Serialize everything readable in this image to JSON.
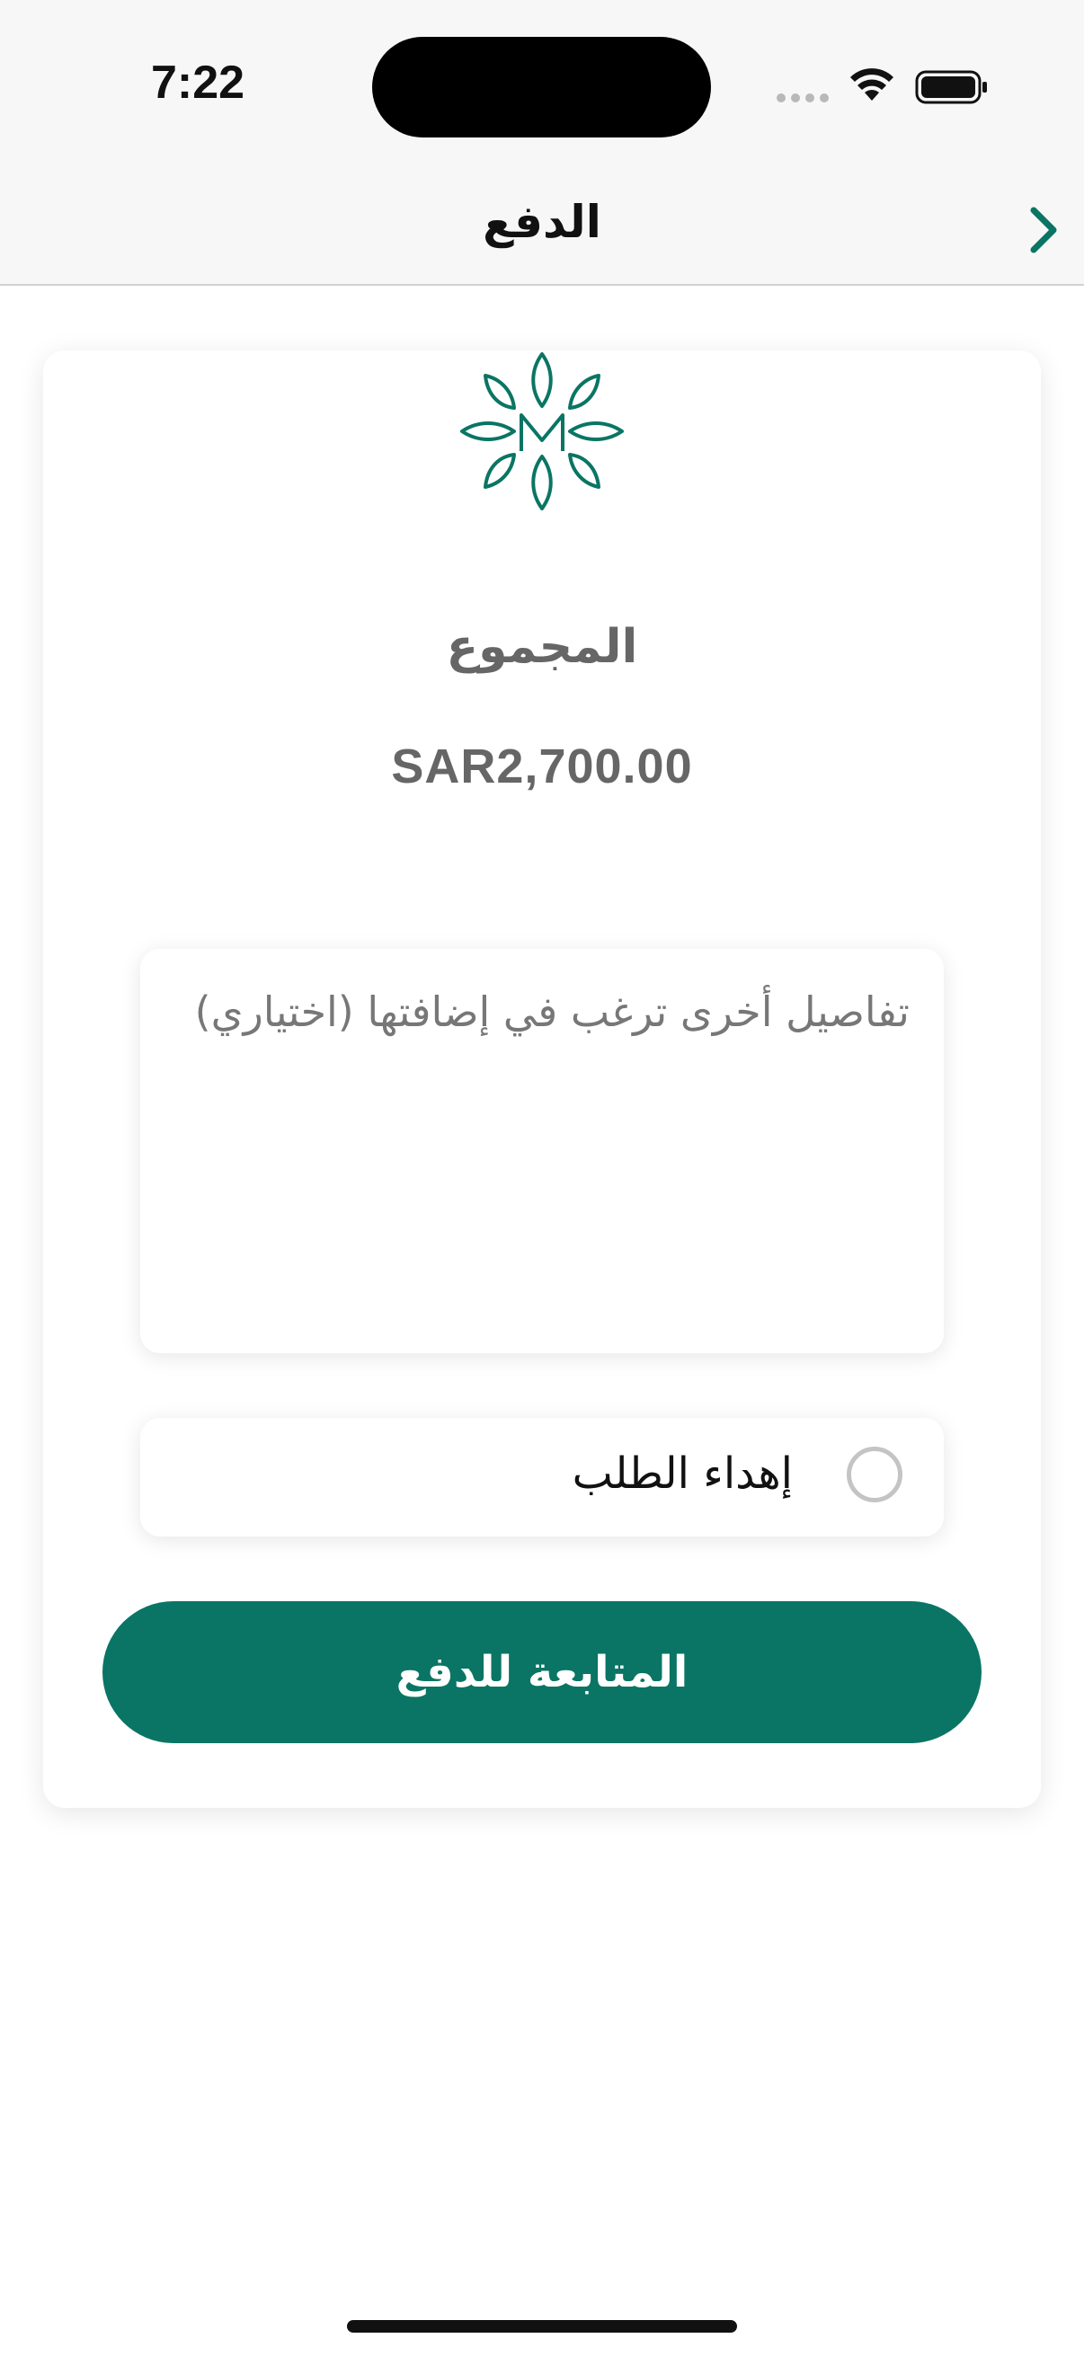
{
  "status_bar": {
    "time": "7:22",
    "icons": [
      "signal-dots-icon",
      "wifi-icon",
      "battery-icon"
    ]
  },
  "nav": {
    "title": "الدفع",
    "back_icon": "chevron-right-icon"
  },
  "card": {
    "logo_icon": "brand-leaf-logo-icon",
    "total_label": "المجموع",
    "total_value": "SAR2,700.00",
    "notes_placeholder": "تفاصيل أخرى ترغب في إضافتها (اختياري)",
    "notes_value": "",
    "gift_label": "إهداء الطلب",
    "gift_checked": false,
    "pay_button_label": "المتابعة للدفع"
  },
  "colors": {
    "brand_green": "#0a7564",
    "header_bg": "#f7f7f7",
    "muted_text": "#666666"
  }
}
